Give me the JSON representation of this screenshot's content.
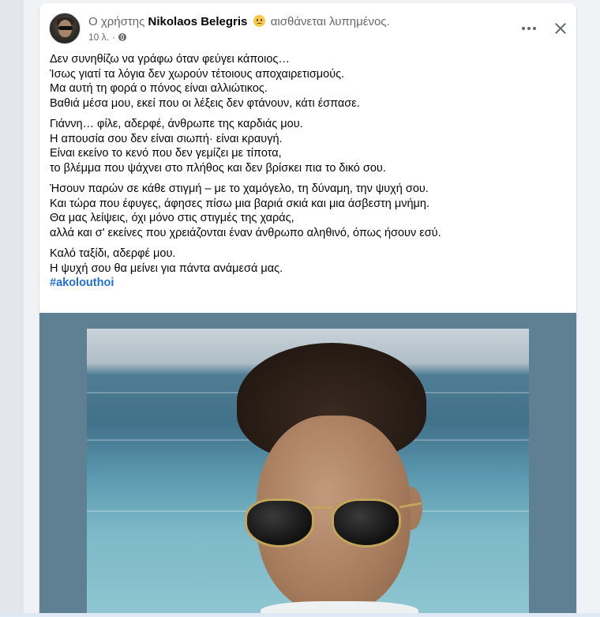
{
  "post": {
    "header": {
      "prefix": "Ο χρήστης",
      "author": "Nikolaos Belegris",
      "feeling": "αισθάνεται λυπημένος.",
      "time": "10 λ.",
      "separator": "·"
    },
    "paragraphs": [
      [
        "Δεν συνηθίζω να γράφω όταν φεύγει κάποιος…",
        "Ίσως γιατί τα λόγια δεν χωρούν τέτοιους αποχαιρετισμούς.",
        "Μα αυτή τη φορά ο πόνος είναι αλλιώτικος.",
        "Βαθιά μέσα μου, εκεί που οι λέξεις δεν φτάνουν, κάτι έσπασε."
      ],
      [
        "Γιάννη… φίλε, αδερφέ, άνθρωπε της καρδιάς μου.",
        "Η απουσία σου δεν είναι σιωπή· είναι κραυγή.",
        "Είναι εκείνο το κενό που δεν γεμίζει με τίποτα,",
        "το βλέμμα που ψάχνει στο πλήθος και δεν βρίσκει πια το δικό σου."
      ],
      [
        "Ήσουν παρών σε κάθε στιγμή – με το χαμόγελο, τη δύναμη, την ψυχή σου.",
        "Και τώρα που έφυγες, άφησες πίσω μια βαριά σκιά και μια άσβεστη μνήμη.",
        "Θα μας λείψεις, όχι μόνο στις στιγμές της χαράς,",
        "αλλά και σ' εκείνες που χρειάζονται έναν άνθρωπο αληθινό, όπως ήσουν εσύ."
      ],
      [
        "Καλό ταξίδι, αδερφέ μου.",
        "Η ψυχή σου θα μείνει για πάντα ανάμεσά μας."
      ]
    ],
    "hashtag": "#akolouthoi"
  },
  "icons": {
    "privacy": "globe-icon",
    "feeling": "sad-face-emoji",
    "more": "more-options-icon",
    "close": "close-icon"
  },
  "colors": {
    "link": "#216fdb",
    "text": "#050505",
    "secondary": "#65676b",
    "background": "#f0f2f5"
  }
}
